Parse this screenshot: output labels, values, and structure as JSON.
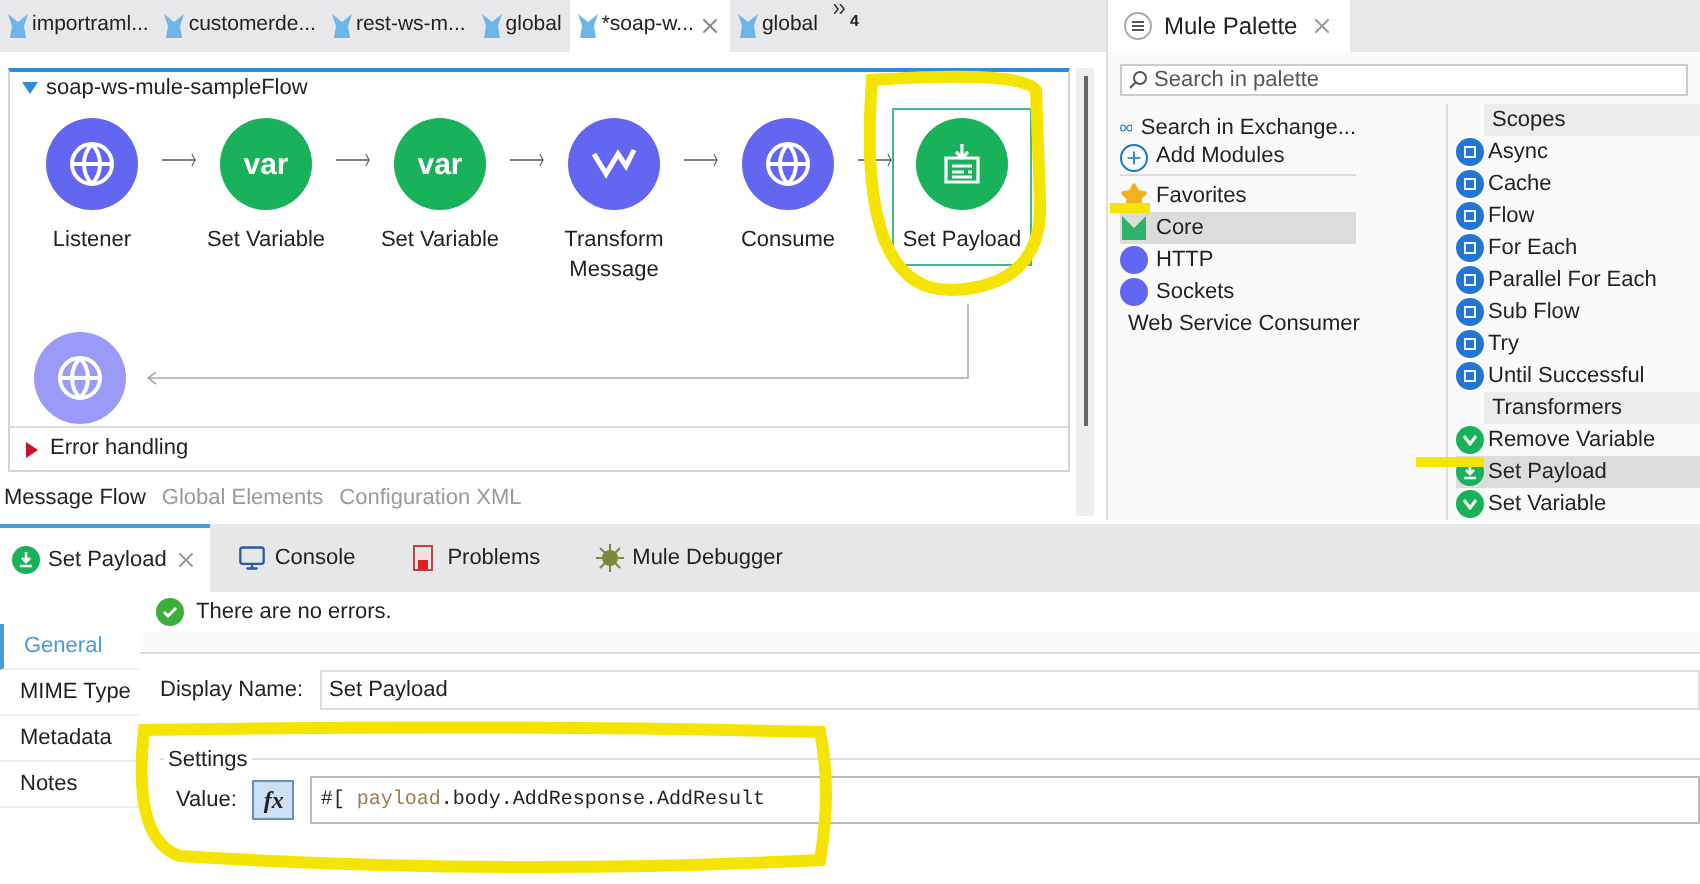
{
  "editor_tabs": [
    {
      "label": "importraml...",
      "selected": false
    },
    {
      "label": "customerde...",
      "selected": false
    },
    {
      "label": "rest-ws-m...",
      "selected": false
    },
    {
      "label": "global",
      "selected": false
    },
    {
      "label": "*soap-w...",
      "selected": true
    },
    {
      "label": "global",
      "selected": false
    }
  ],
  "tabs_overflow": "4",
  "flow": {
    "title": "soap-ws-mule-sampleFlow",
    "nodes": [
      {
        "label": "Listener",
        "kind": "listener",
        "selected": false
      },
      {
        "label": "Set Variable",
        "kind": "variable",
        "icon_text": "var",
        "selected": false
      },
      {
        "label": "Set Variable",
        "kind": "variable",
        "icon_text": "var",
        "selected": false
      },
      {
        "label": "Transform Message",
        "kind": "transform",
        "selected": false
      },
      {
        "label": "Consume",
        "kind": "consume",
        "selected": false
      },
      {
        "label": "Set Payload",
        "kind": "payload",
        "selected": true
      }
    ],
    "error_handling": "Error handling"
  },
  "editor_views": [
    {
      "label": "Message Flow",
      "selected": true
    },
    {
      "label": "Global Elements",
      "selected": false
    },
    {
      "label": "Configuration XML",
      "selected": false
    }
  ],
  "palette": {
    "title": "Mule Palette",
    "search_placeholder": "Search in palette",
    "modules": [
      {
        "label": "Search in Exchange...",
        "kind": "exchange",
        "selected": false
      },
      {
        "label": "Add Modules",
        "kind": "add",
        "selected": false
      },
      {
        "label": "Favorites",
        "kind": "star",
        "selected": false
      },
      {
        "label": "Core",
        "kind": "core",
        "selected": true
      },
      {
        "label": "HTTP",
        "kind": "connector",
        "selected": false
      },
      {
        "label": "Sockets",
        "kind": "connector",
        "selected": false
      },
      {
        "label": "Web Service Consumer",
        "kind": "connector",
        "selected": false
      }
    ],
    "sections": [
      {
        "title": "Scopes",
        "items": [
          {
            "label": "Async",
            "kind": "scope",
            "selected": false
          },
          {
            "label": "Cache",
            "kind": "scope",
            "selected": false
          },
          {
            "label": "Flow",
            "kind": "scope",
            "selected": false
          },
          {
            "label": "For Each",
            "kind": "scope",
            "selected": false
          },
          {
            "label": "Parallel For Each",
            "kind": "scope",
            "selected": false
          },
          {
            "label": "Sub Flow",
            "kind": "scope",
            "selected": false
          },
          {
            "label": "Try",
            "kind": "scope",
            "selected": false
          },
          {
            "label": "Until Successful",
            "kind": "scope",
            "selected": false
          }
        ]
      },
      {
        "title": "Transformers",
        "items": [
          {
            "label": "Remove Variable",
            "kind": "variable",
            "selected": false
          },
          {
            "label": "Set Payload",
            "kind": "payload",
            "selected": true
          },
          {
            "label": "Set Variable",
            "kind": "variable",
            "selected": false
          }
        ]
      }
    ]
  },
  "bottom_tabs": [
    {
      "label": "Set Payload",
      "kind": "payload",
      "selected": true
    },
    {
      "label": "Console",
      "kind": "console",
      "selected": false
    },
    {
      "label": "Problems",
      "kind": "problems",
      "selected": false
    },
    {
      "label": "Mule Debugger",
      "kind": "debugger",
      "selected": false
    }
  ],
  "properties": {
    "status": "There are no errors.",
    "nav": [
      {
        "label": "General",
        "selected": true
      },
      {
        "label": "MIME Type",
        "selected": false
      },
      {
        "label": "Metadata",
        "selected": false
      },
      {
        "label": "Notes",
        "selected": false
      }
    ],
    "display_name_label": "Display Name:",
    "display_name": "Set Payload",
    "settings_title": "Settings",
    "value_label": "Value:",
    "fx": "fx",
    "expression_prefix": "#[",
    "expression_keyword": "payload",
    "expression_rest": ".body.AddResponse.AddResult"
  }
}
